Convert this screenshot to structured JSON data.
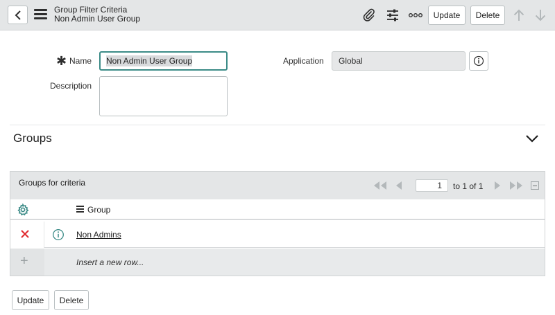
{
  "header": {
    "title": "Group Filter Criteria",
    "subtitle": "Non Admin User Group",
    "update_label": "Update",
    "delete_label": "Delete"
  },
  "form": {
    "name_label": "Name",
    "name_value": "Non Admin User Group",
    "description_label": "Description",
    "application_label": "Application",
    "application_value": "Global"
  },
  "section": {
    "title": "Groups"
  },
  "related_list": {
    "title": "Groups for criteria",
    "page_input": "1",
    "page_text": "to 1 of 1",
    "column_header": "Group",
    "rows": [
      {
        "group": "Non Admins"
      }
    ],
    "insert_text": "Insert a new row..."
  },
  "footer": {
    "update_label": "Update",
    "delete_label": "Delete"
  },
  "colors": {
    "accent": "#3b8b87",
    "delete_x": "#e0262b",
    "header_bg": "#e4e6e7"
  }
}
